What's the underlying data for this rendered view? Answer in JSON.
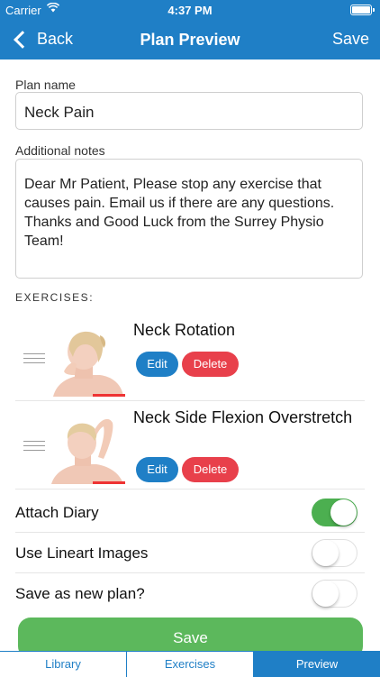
{
  "status_bar": {
    "carrier": "Carrier",
    "time": "4:37 PM"
  },
  "nav": {
    "back_label": "Back",
    "title": "Plan Preview",
    "save_label": "Save"
  },
  "plan_name": {
    "label": "Plan name",
    "value": "Neck Pain"
  },
  "notes": {
    "label": "Additional notes",
    "value": "Dear Mr Patient, Please stop any exercise that causes pain. Email us if there are any questions. Thanks and Good Luck from the Surrey Physio Team!"
  },
  "exercises": {
    "section_label": "EXERCISES:",
    "items": [
      {
        "title": "Neck Rotation",
        "edit_label": "Edit",
        "delete_label": "Delete"
      },
      {
        "title": "Neck Side Flexion Overstretch",
        "edit_label": "Edit",
        "delete_label": "Delete"
      }
    ]
  },
  "settings": [
    {
      "label": "Attach Diary",
      "enabled": true
    },
    {
      "label": "Use Lineart Images",
      "enabled": false
    },
    {
      "label": "Save as new plan?",
      "enabled": false
    }
  ],
  "save_button": {
    "label": "Save"
  },
  "tabs": [
    {
      "label": "Library",
      "active": false
    },
    {
      "label": "Exercises",
      "active": false
    },
    {
      "label": "Preview",
      "active": true
    }
  ],
  "colors": {
    "brand_blue": "#1f7fc6",
    "toggle_on": "#4caf50",
    "save_green": "#5cb85c",
    "delete_red": "#e8404b"
  }
}
